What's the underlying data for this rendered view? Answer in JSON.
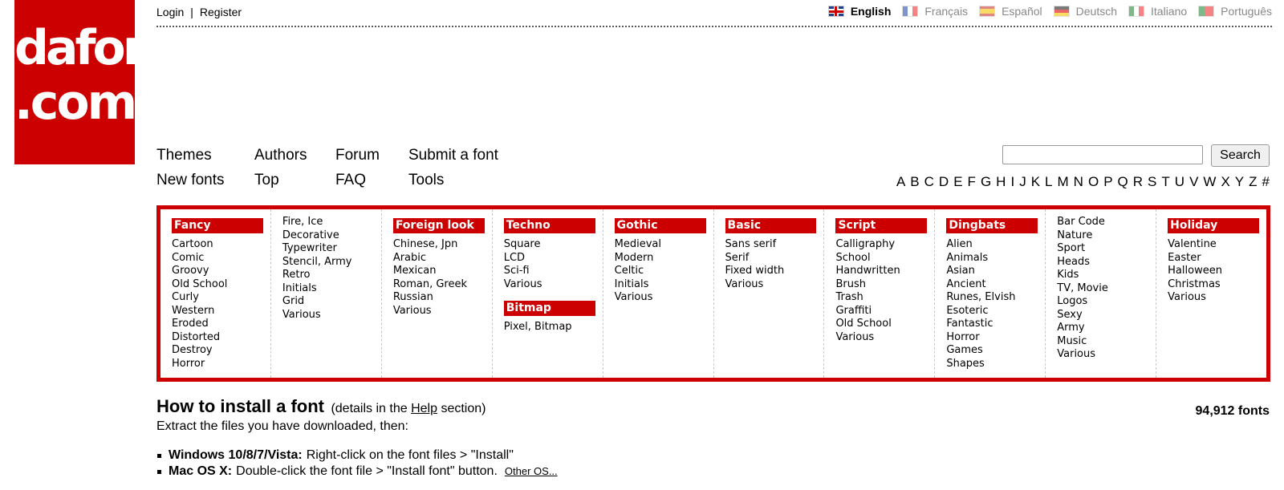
{
  "logo": {
    "line1": "dafont",
    "line2": ".com"
  },
  "auth": {
    "login": "Login",
    "separator": "|",
    "register": "Register"
  },
  "languages": [
    {
      "label": "English",
      "flag": "uk-flag-icon",
      "active": true
    },
    {
      "label": "Français",
      "flag": "france-flag-icon"
    },
    {
      "label": "Español",
      "flag": "spain-flag-icon"
    },
    {
      "label": "Deutsch",
      "flag": "germany-flag-icon"
    },
    {
      "label": "Italiano",
      "flag": "italy-flag-icon"
    },
    {
      "label": "Português",
      "flag": "portugal-flag-icon"
    }
  ],
  "nav": {
    "themes": "Themes",
    "authors": "Authors",
    "forum": "Forum",
    "submit": "Submit a font",
    "new_fonts": "New fonts",
    "top": "Top",
    "faq": "FAQ",
    "tools": "Tools"
  },
  "search": {
    "button": "Search",
    "placeholder": ""
  },
  "alphabet": [
    "A",
    "B",
    "C",
    "D",
    "E",
    "F",
    "G",
    "H",
    "I",
    "J",
    "K",
    "L",
    "M",
    "N",
    "O",
    "P",
    "Q",
    "R",
    "S",
    "T",
    "U",
    "V",
    "W",
    "X",
    "Y",
    "Z",
    "#"
  ],
  "categories": {
    "fancy": {
      "title": "Fancy",
      "items": [
        "Cartoon",
        "Comic",
        "Groovy",
        "Old School",
        "Curly",
        "Western",
        "Eroded",
        "Distorted",
        "Destroy",
        "Horror"
      ]
    },
    "fancy2": {
      "items": [
        "Fire, Ice",
        "Decorative",
        "Typewriter",
        "Stencil, Army",
        "Retro",
        "Initials",
        "Grid",
        "Various"
      ]
    },
    "foreign": {
      "title": "Foreign look",
      "items": [
        "Chinese, Jpn",
        "Arabic",
        "Mexican",
        "Roman, Greek",
        "Russian",
        "Various"
      ]
    },
    "techno": {
      "title": "Techno",
      "items": [
        "Square",
        "LCD",
        "Sci-fi",
        "Various"
      ]
    },
    "bitmap": {
      "title": "Bitmap",
      "items": [
        "Pixel, Bitmap"
      ]
    },
    "gothic": {
      "title": "Gothic",
      "items": [
        "Medieval",
        "Modern",
        "Celtic",
        "Initials",
        "Various"
      ]
    },
    "basic": {
      "title": "Basic",
      "items": [
        "Sans serif",
        "Serif",
        "Fixed width",
        "Various"
      ]
    },
    "script": {
      "title": "Script",
      "items": [
        "Calligraphy",
        "School",
        "Handwritten",
        "Brush",
        "Trash",
        "Graffiti",
        "Old School",
        "Various"
      ]
    },
    "dingbats": {
      "title": "Dingbats",
      "items": [
        "Alien",
        "Animals",
        "Asian",
        "Ancient",
        "Runes, Elvish",
        "Esoteric",
        "Fantastic",
        "Horror",
        "Games",
        "Shapes"
      ]
    },
    "dingbats2": {
      "items": [
        "Bar Code",
        "Nature",
        "Sport",
        "Heads",
        "Kids",
        "TV, Movie",
        "Logos",
        "Sexy",
        "Army",
        "Music",
        "Various"
      ]
    },
    "holiday": {
      "title": "Holiday",
      "items": [
        "Valentine",
        "Easter",
        "Halloween",
        "Christmas",
        "Various"
      ]
    }
  },
  "howto": {
    "title": "How to install a font",
    "details_pre": "(details in the",
    "details_link": "Help",
    "details_post": "section)",
    "subtitle": "Extract the files you have downloaded, then:",
    "count": "94,912 fonts",
    "steps": [
      {
        "os": "Windows 10/8/7/Vista:",
        "text": "Right-click on the font files > \"Install\""
      },
      {
        "os": "Mac OS X:",
        "text": "Double-click the font file > \"Install font\" button.",
        "link": "Other OS..."
      }
    ]
  }
}
